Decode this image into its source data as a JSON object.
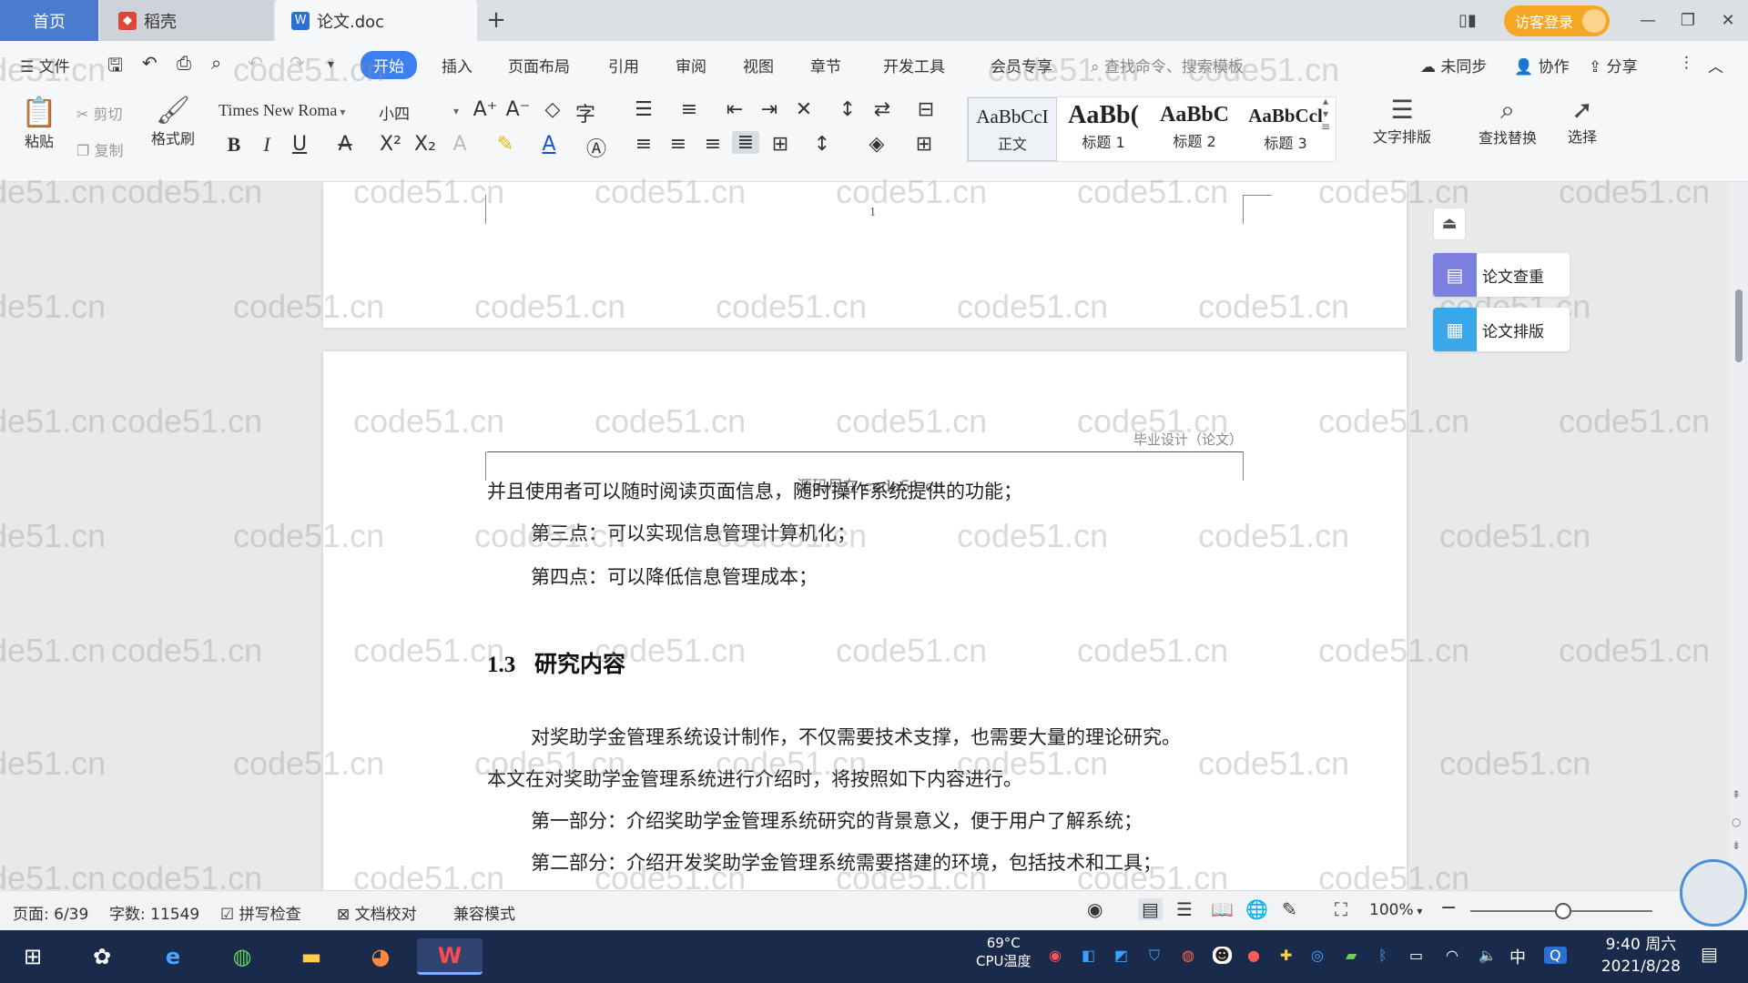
{
  "tabs": {
    "home": "首页",
    "shell": "稻壳",
    "doc": "论文.doc"
  },
  "window": {
    "visitor_login": "访客登录"
  },
  "menu": {
    "file": "文件",
    "items": [
      "开始",
      "插入",
      "页面布局",
      "引用",
      "审阅",
      "视图",
      "章节",
      "开发工具",
      "会员专享"
    ],
    "search_placeholder": "查找命令、搜索模板",
    "unsynced": "未同步",
    "collab": "协作",
    "share": "分享"
  },
  "ribbon": {
    "paste": "粘贴",
    "cut": "剪切",
    "copy": "复制",
    "format_painter": "格式刷",
    "font_name": "Times New Roma",
    "font_size": "小四",
    "styles": [
      {
        "sample": "AaBbCcI",
        "label": "正文"
      },
      {
        "sample": "AaBb(",
        "label": "标题 1"
      },
      {
        "sample": "AaBbC",
        "label": "标题 2"
      },
      {
        "sample": "AaBbCcl",
        "label": "标题 3"
      }
    ],
    "text_layout": "文字排版",
    "find_replace": "查找替换",
    "select": "选择"
  },
  "side_panel": {
    "check": "论文查重",
    "layout": "论文排版"
  },
  "document": {
    "page_number": "1",
    "header": "毕业设计（论文）",
    "overlap": "源码尽在 code51.cn",
    "paragraphs": [
      "并且使用者可以随时阅读页面信息，随时操作系统提供的功能；",
      "第三点：可以实现信息管理计算机化；",
      "第四点：可以降低信息管理成本；",
      "对奖助学金管理系统设计制作，不仅需要技术支撑，也需要大量的理论研究。",
      "本文在对奖助学金管理系统进行介绍时，将按照如下内容进行。",
      "第一部分：介绍奖助学金管理系统研究的背景意义，便于用户了解系统；",
      "第二部分：介绍开发奖助学金管理系统需要搭建的环境，包括技术和工具；"
    ],
    "heading_num": "1.3",
    "heading_text": "研究内容"
  },
  "watermark": "code51.cn",
  "status": {
    "page": "页面: 6/39",
    "words": "字数: 11549",
    "spell": "拼写检查",
    "proof": "文档校对",
    "compat": "兼容模式",
    "zoom": "100%"
  },
  "taskbar": {
    "cpu_temp": "69°C",
    "cpu_label": "CPU温度",
    "ime": "中",
    "time": "9:40 周六",
    "date": "2021/8/28"
  }
}
